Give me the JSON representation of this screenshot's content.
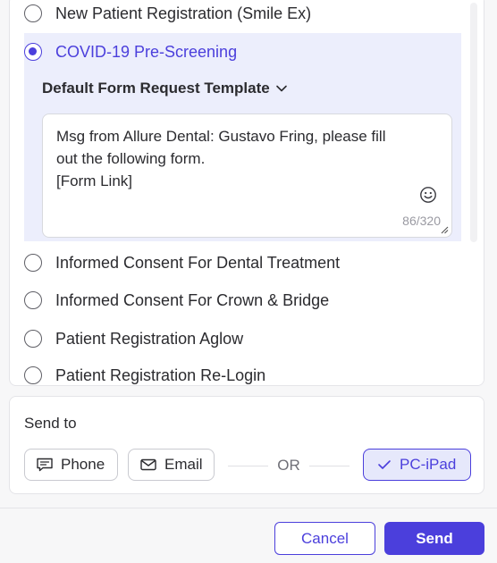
{
  "forms": {
    "items_above": [
      {
        "label": "New Patient Registration (Smile Ex)",
        "checked": false
      }
    ],
    "selected": {
      "label": "COVID-19 Pre-Screening",
      "template_label": "Default Form Request Template",
      "message": "Msg from Allure Dental: Gustavo Fring, please fill\nout the following form.\n[Form Link]",
      "counter": "86/320"
    },
    "items_below": [
      {
        "label": "Informed Consent For Dental Treatment",
        "checked": false
      },
      {
        "label": "Informed Consent For Crown & Bridge",
        "checked": false
      },
      {
        "label": "Patient Registration Aglow",
        "checked": false
      },
      {
        "label": "Patient Registration Re-Login",
        "checked": false
      }
    ]
  },
  "send_to": {
    "title": "Send to",
    "phone_label": "Phone",
    "email_label": "Email",
    "or_label": "OR",
    "pc_label": "PC-iPad",
    "pc_selected": true
  },
  "footer": {
    "cancel_label": "Cancel",
    "send_label": "Send"
  },
  "colors": {
    "accent": "#4b3fdc",
    "selected_bg": "#eceefc",
    "pc_bg": "#e6e8fb"
  },
  "icons": [
    "radio-unchecked",
    "radio-checked",
    "chevron-down-icon",
    "emoji-icon",
    "resize-handle-icon",
    "chat-icon",
    "mail-icon",
    "check-icon"
  ]
}
